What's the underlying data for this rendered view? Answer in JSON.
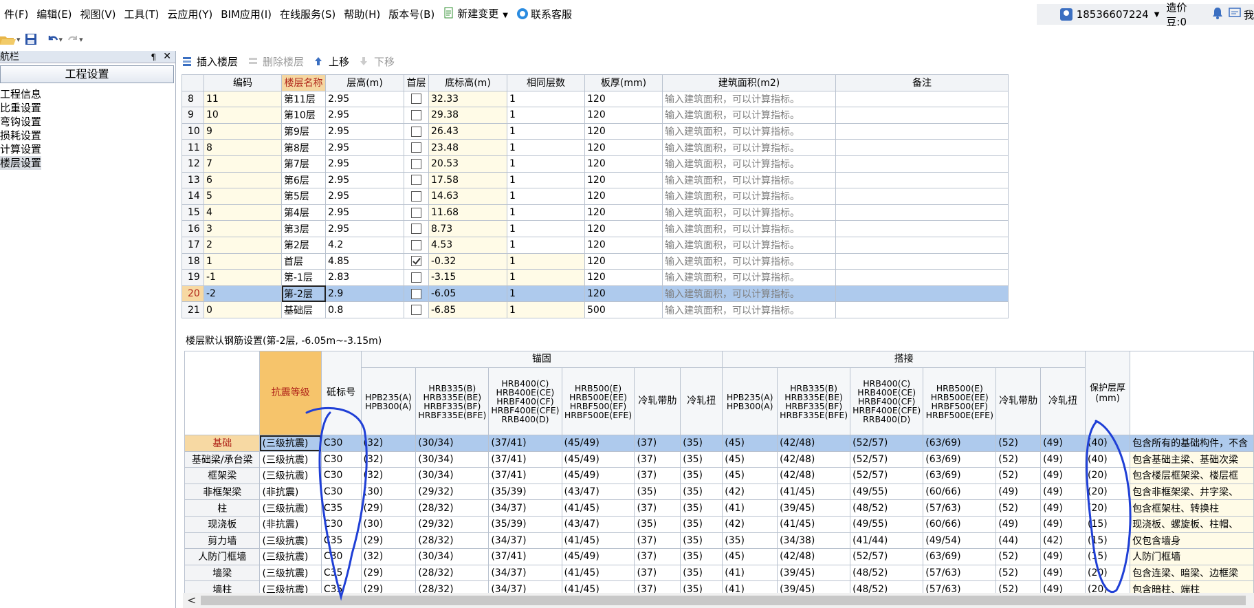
{
  "menubar": {
    "items": [
      "件(F)",
      "编辑(E)",
      "视图(V)",
      "工具(T)",
      "云应用(Y)",
      "BIM应用(I)",
      "在线服务(S)",
      "帮助(H)",
      "版本号(B)"
    ],
    "new_change": "新建变更",
    "contact": "联系客服",
    "phone": "18536607224",
    "price_beans": "造价豆:0",
    "truncated_tail": "我"
  },
  "nav": {
    "title": "导航栏",
    "pin": "¶",
    "close": "✕",
    "header": "工程设置",
    "items": [
      "工程信息",
      "比重设置",
      "弯钩设置",
      "损耗设置",
      "计算设置",
      "楼层设置"
    ],
    "selected_index": 5
  },
  "floor_toolbar": {
    "insert": "插入楼层",
    "delete": "删除楼层",
    "up": "上移",
    "down": "下移"
  },
  "floor_table": {
    "headers": [
      "",
      "编码",
      "楼层名称",
      "层高(m)",
      "首层",
      "底标高(m)",
      "相同层数",
      "板厚(mm)",
      "建筑面积(m2)",
      "备注"
    ],
    "hint": "输入建筑面积，可以计算指标。",
    "selected_row": 20,
    "rows": [
      {
        "n": "8",
        "code": "11",
        "name": "第11层",
        "h": "2.95",
        "first": false,
        "elev": "32.33",
        "same": "1",
        "slab": "120"
      },
      {
        "n": "9",
        "code": "10",
        "name": "第10层",
        "h": "2.95",
        "first": false,
        "elev": "29.38",
        "same": "1",
        "slab": "120"
      },
      {
        "n": "10",
        "code": "9",
        "name": "第9层",
        "h": "2.95",
        "first": false,
        "elev": "26.43",
        "same": "1",
        "slab": "120"
      },
      {
        "n": "11",
        "code": "8",
        "name": "第8层",
        "h": "2.95",
        "first": false,
        "elev": "23.48",
        "same": "1",
        "slab": "120"
      },
      {
        "n": "12",
        "code": "7",
        "name": "第7层",
        "h": "2.95",
        "first": false,
        "elev": "20.53",
        "same": "1",
        "slab": "120"
      },
      {
        "n": "13",
        "code": "6",
        "name": "第6层",
        "h": "2.95",
        "first": false,
        "elev": "17.58",
        "same": "1",
        "slab": "120"
      },
      {
        "n": "14",
        "code": "5",
        "name": "第5层",
        "h": "2.95",
        "first": false,
        "elev": "14.63",
        "same": "1",
        "slab": "120"
      },
      {
        "n": "15",
        "code": "4",
        "name": "第4层",
        "h": "2.95",
        "first": false,
        "elev": "11.68",
        "same": "1",
        "slab": "120"
      },
      {
        "n": "16",
        "code": "3",
        "name": "第3层",
        "h": "2.95",
        "first": false,
        "elev": "8.73",
        "same": "1",
        "slab": "120"
      },
      {
        "n": "17",
        "code": "2",
        "name": "第2层",
        "h": "4.2",
        "first": false,
        "elev": "4.53",
        "same": "1",
        "slab": "120"
      },
      {
        "n": "18",
        "code": "1",
        "name": "首层",
        "h": "4.85",
        "first": true,
        "elev": "-0.32",
        "same": "1",
        "slab": "120"
      },
      {
        "n": "19",
        "code": "-1",
        "name": "第-1层",
        "h": "2.83",
        "first": false,
        "elev": "-3.15",
        "same": "1",
        "slab": "120"
      },
      {
        "n": "20",
        "code": "-2",
        "name": "第-2层",
        "h": "2.9",
        "first": false,
        "elev": "-6.05",
        "same": "1",
        "slab": "120"
      },
      {
        "n": "21",
        "code": "0",
        "name": "基础层",
        "h": "0.8",
        "first": false,
        "elev": "-6.85",
        "same": "1",
        "slab": "500"
      }
    ]
  },
  "rebar": {
    "title": "楼层默认钢筋设置(第-2层, -6.05m~-3.15m)",
    "group_anchor": "锚固",
    "group_lap": "搭接",
    "col_seismic": "抗震等级",
    "col_concrete": "砥标号",
    "col_cover": "保护层厚(mm)",
    "sub": [
      "HPB235(A)\nHPB300(A)",
      "HRB335(B)\nHRB335E(BE)\nHRBF335(BF)\nHRBF335E(BFE)",
      "HRB400(C)\nHRB400E(CE)\nHRBF400(CF)\nHRBF400E(CFE)\nRRB400(D)",
      "HRB500(E)\nHRB500E(EE)\nHRBF500(EF)\nHRBF500E(EFE)",
      "冷轧带肋",
      "冷轧扭"
    ],
    "rows": [
      {
        "name": "基础",
        "seis": "(三级抗震)",
        "c": "C30",
        "a": [
          "(32)",
          "(30/34)",
          "(37/41)",
          "(45/49)",
          "(37)",
          "(35)"
        ],
        "l": [
          "(45)",
          "(42/48)",
          "(52/57)",
          "(63/69)",
          "(52)",
          "(49)"
        ],
        "cov": "(40)",
        "note": "包含所有的基础构件，不含"
      },
      {
        "name": "基础梁/承台梁",
        "seis": "(三级抗震)",
        "c": "C30",
        "a": [
          "(32)",
          "(30/34)",
          "(37/41)",
          "(45/49)",
          "(37)",
          "(35)"
        ],
        "l": [
          "(45)",
          "(42/48)",
          "(52/57)",
          "(63/69)",
          "(52)",
          "(49)"
        ],
        "cov": "(40)",
        "note": "包含基础主梁、基础次梁"
      },
      {
        "name": "框架梁",
        "seis": "(三级抗震)",
        "c": "C30",
        "a": [
          "(32)",
          "(30/34)",
          "(37/41)",
          "(45/49)",
          "(37)",
          "(35)"
        ],
        "l": [
          "(45)",
          "(42/48)",
          "(52/57)",
          "(63/69)",
          "(52)",
          "(49)"
        ],
        "cov": "(20)",
        "note": "包含楼层框架梁、楼层框"
      },
      {
        "name": "非框架梁",
        "seis": "(非抗震)",
        "c": "C30",
        "a": [
          "(30)",
          "(29/32)",
          "(35/39)",
          "(43/47)",
          "(35)",
          "(35)"
        ],
        "l": [
          "(42)",
          "(41/45)",
          "(49/55)",
          "(60/66)",
          "(49)",
          "(49)"
        ],
        "cov": "(20)",
        "note": "包含非框架梁、井字梁、"
      },
      {
        "name": "柱",
        "seis": "(三级抗震)",
        "c": "C35",
        "a": [
          "(29)",
          "(28/32)",
          "(34/37)",
          "(41/45)",
          "(37)",
          "(35)"
        ],
        "l": [
          "(41)",
          "(39/45)",
          "(48/52)",
          "(57/63)",
          "(52)",
          "(49)"
        ],
        "cov": "(20)",
        "note": "包含框架柱、转换柱"
      },
      {
        "name": "现浇板",
        "seis": "(非抗震)",
        "c": "C30",
        "a": [
          "(30)",
          "(29/32)",
          "(35/39)",
          "(43/47)",
          "(35)",
          "(35)"
        ],
        "l": [
          "(42)",
          "(41/45)",
          "(49/55)",
          "(60/66)",
          "(49)",
          "(49)"
        ],
        "cov": "(15)",
        "note": "现浇板、螺旋板、柱帽、"
      },
      {
        "name": "剪力墙",
        "seis": "(三级抗震)",
        "c": "C35",
        "a": [
          "(29)",
          "(28/32)",
          "(34/37)",
          "(41/45)",
          "(37)",
          "(35)"
        ],
        "l": [
          "(35)",
          "(34/38)",
          "(41/44)",
          "(49/54)",
          "(44)",
          "(42)"
        ],
        "cov": "(15)",
        "note": "仅包含墙身"
      },
      {
        "name": "人防门框墙",
        "seis": "(三级抗震)",
        "c": "C30",
        "a": [
          "(32)",
          "(30/34)",
          "(37/41)",
          "(45/49)",
          "(37)",
          "(35)"
        ],
        "l": [
          "(45)",
          "(42/48)",
          "(52/57)",
          "(63/69)",
          "(52)",
          "(49)"
        ],
        "cov": "(15)",
        "note": "人防门框墙"
      },
      {
        "name": "墙梁",
        "seis": "(三级抗震)",
        "c": "C35",
        "a": [
          "(29)",
          "(28/32)",
          "(34/37)",
          "(41/45)",
          "(37)",
          "(35)"
        ],
        "l": [
          "(41)",
          "(39/45)",
          "(48/52)",
          "(57/63)",
          "(52)",
          "(49)"
        ],
        "cov": "(20)",
        "note": "包含连梁、暗梁、边框梁"
      },
      {
        "name": "墙柱",
        "seis": "(三级抗震)",
        "c": "C35",
        "a": [
          "(29)",
          "(28/32)",
          "(34/37)",
          "(41/45)",
          "(37)",
          "(35)"
        ],
        "l": [
          "(41)",
          "(39/45)",
          "(48/52)",
          "(57/63)",
          "(52)",
          "(49)"
        ],
        "cov": "(20)",
        "note": "包含暗柱、端柱"
      }
    ]
  },
  "scroll": {
    "left_arrow": "<"
  },
  "colors": {
    "accent": "#f6c46b",
    "selection": "#aecaed",
    "annotation": "#1f3fd6"
  }
}
